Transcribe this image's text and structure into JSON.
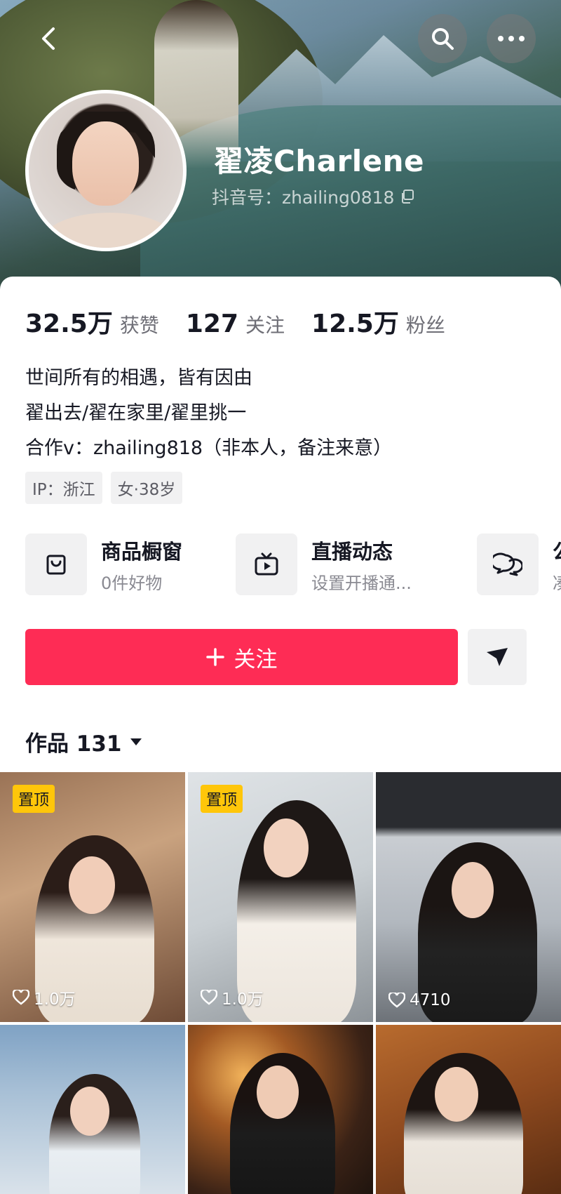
{
  "header": {
    "profile_name": "翟凌Charlene",
    "account_id": "抖音号：zhailing0818"
  },
  "stats": [
    {
      "value": "32.5万",
      "label": "获赞"
    },
    {
      "value": "127",
      "label": "关注"
    },
    {
      "value": "12.5万",
      "label": "粉丝"
    }
  ],
  "bio": {
    "line1": "世间所有的相遇，皆有因由",
    "line2": "翟出去/翟在家里/翟里挑一",
    "line3": "合作v：zhailing818（非本人，备注来意）"
  },
  "tags": [
    "IP：浙江",
    "女·38岁"
  ],
  "features": [
    {
      "title": "商品橱窗",
      "subtitle": "0件好物",
      "icon": "shopping-bag-icon"
    },
    {
      "title": "直播动态",
      "subtitle": "设置开播通...",
      "icon": "tv-icon"
    },
    {
      "title": "公",
      "subtitle": "凑",
      "icon": "chat-bubbles-icon"
    }
  ],
  "actions": {
    "follow_label": "关注",
    "follow_color": "#fe2c55"
  },
  "works": {
    "title": "作品 131",
    "pinned_label": "置顶",
    "tiles": [
      {
        "pinned": true,
        "likes": "1.0万"
      },
      {
        "pinned": true,
        "likes": "1.0万"
      },
      {
        "pinned": false,
        "likes": "4710"
      },
      {
        "pinned": false,
        "likes": ""
      },
      {
        "pinned": false,
        "likes": ""
      },
      {
        "pinned": false,
        "likes": ""
      }
    ]
  }
}
